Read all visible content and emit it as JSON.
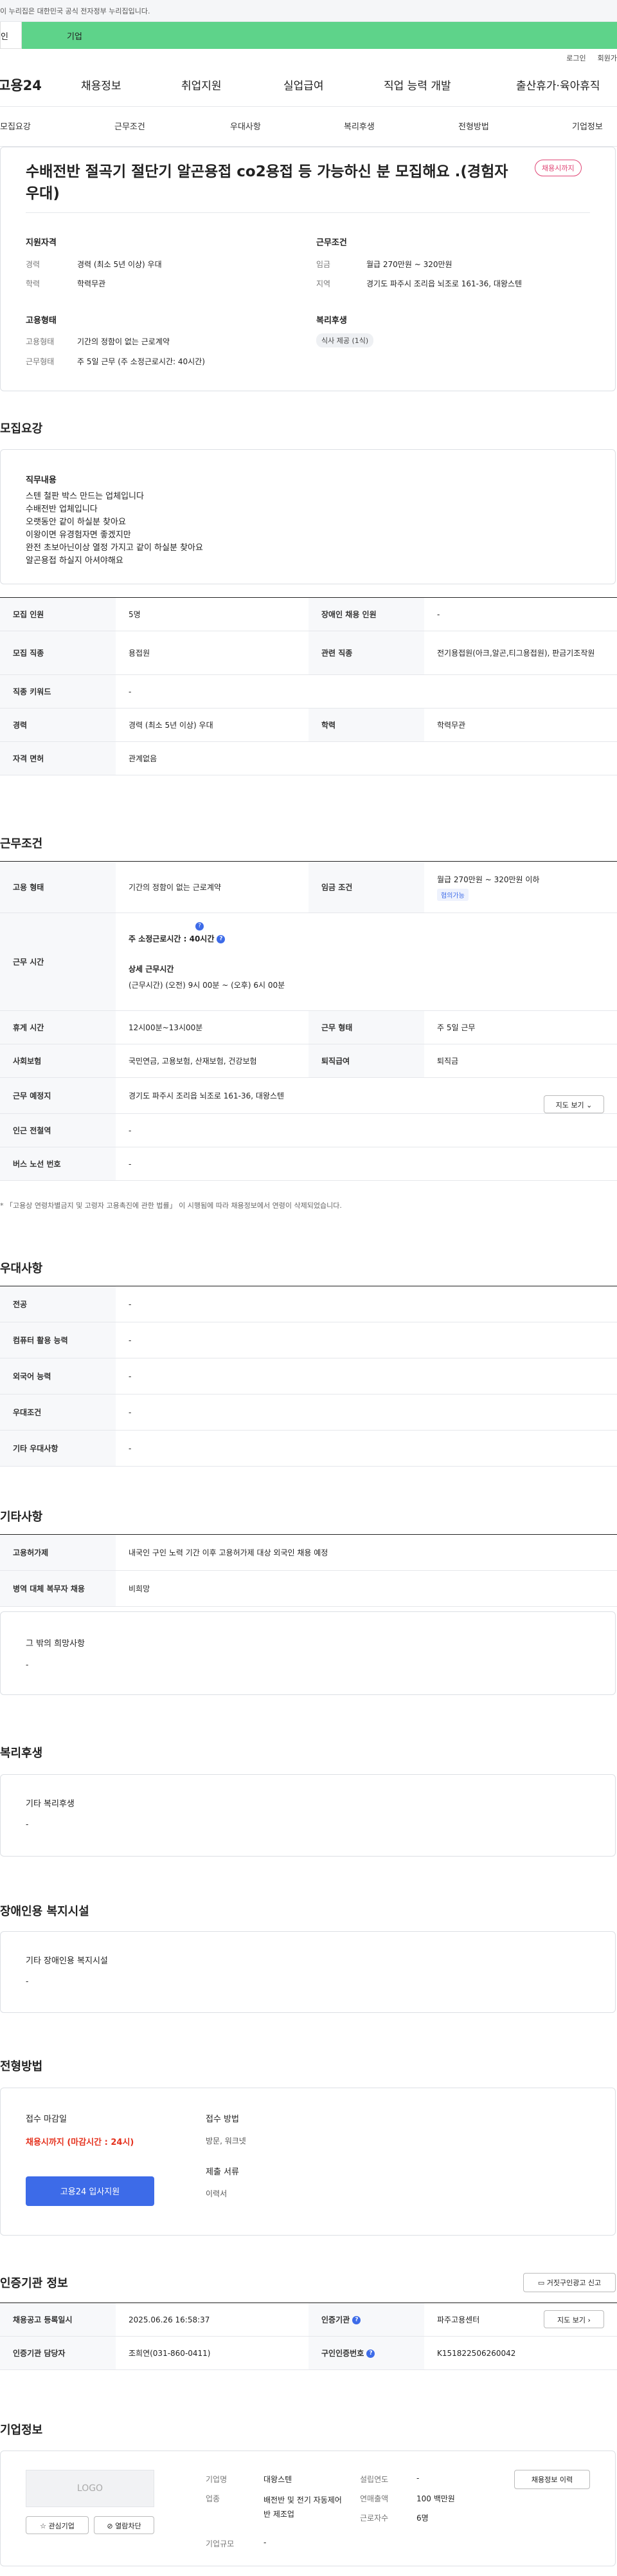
{
  "header": {
    "gov_notice": "이 누리집은 대한민국 공식 전자정부 누리집입니다.",
    "tab_left": "인",
    "tab_right": "기업",
    "util": [
      "로그인",
      "회원가"
    ],
    "logo": "고용24",
    "gnb": [
      "채용정보",
      "취업지원",
      "실업급여",
      "직업 능력 개발",
      "출산휴가·육아휴직"
    ],
    "snb": [
      "모집요강",
      "근무조건",
      "우대사항",
      "복리후생",
      "전형방법",
      "기업정보"
    ]
  },
  "summary": {
    "title": "수배전반 절곡기 절단기 알곤용접 co2용접 등 가능하신 분 모집해요 .(경험자우대)",
    "status": "채용시까지",
    "qual_title": "지원자격",
    "qual": [
      {
        "k": "경력",
        "v": "경력 (최소 5년 이상) 우대"
      },
      {
        "k": "학력",
        "v": "학력무관"
      }
    ],
    "work_title": "근무조건",
    "work": [
      {
        "k": "임금",
        "v": "월급 270만원 ~ 320만원"
      },
      {
        "k": "지역",
        "v": "경기도 파주시 조리읍 뇌조로 161-36, 대왕스텐"
      }
    ],
    "emp_title": "고용형태",
    "emp": [
      {
        "k": "고용형태",
        "v": "기간의 정함이 없는 근로계약"
      },
      {
        "k": "근무형태",
        "v": "주 5일 근무 (주 소정근로시간: 40시간)"
      }
    ],
    "welfare_title": "복리후생",
    "welfare_tag": "식사 제공 (1식)"
  },
  "recruit": {
    "heading": "모집요강",
    "job_title": "직무내용",
    "job_text": "스텐 철판 박스 만드는 업체입니다\n수배전반 업체입니다\n오랫동안 같이 하실분 찾아요\n이왕이면 유경험자면 좋겠지만\n완전 초보아닌이상 열정 가지고 같이 하실분 찾아요\n알곤용접 하실지 아셔야해요",
    "rows": [
      [
        "모집 인원",
        "5명",
        "장애인 채용 인원",
        "-"
      ],
      [
        "모집 직종",
        "용접원",
        "관련 직종",
        "전기용접원(아크,알곤,티그용접원), 판금기조작원"
      ],
      [
        "직종 키워드",
        "-"
      ],
      [
        "경력",
        "경력 (최소 5년 이상) 우대",
        "학력",
        "학력무관"
      ],
      [
        "자격 면허",
        "관계없음"
      ]
    ]
  },
  "conditions": {
    "heading": "근무조건",
    "emp_type_k": "고용 형태",
    "emp_type_v": "기간의 정함이 없는 근로계약",
    "wage_k": "임금 조건",
    "wage_v": "월급 270만원 ~ 320만원 이하",
    "wage_tag": "협의가능",
    "hours_k": "근무 시간",
    "hours_main": "주 소정근로시간 : 40시간",
    "hours_detail_title": "상세 근무시간",
    "hours_detail": "(근무시간) (오전) 9시 00분 ~ (오후) 6시 00분",
    "rows": [
      [
        "휴게 시간",
        "12시00분~13시00분",
        "근무 형태",
        "주 5일 근무"
      ],
      [
        "사회보험",
        "국민연금, 고용보험, 산재보험, 건강보험",
        "퇴직급여",
        "퇴직금"
      ],
      [
        "근무 예정지",
        "경기도 파주시 조리읍 뇌조로 161-36, 대왕스텐"
      ],
      [
        "인근 전철역",
        "-"
      ],
      [
        "버스 노선 번호",
        "-"
      ]
    ],
    "map_btn": "지도 보기",
    "note": "* 「고용상 연령차별금지 및 고령자 고용촉진에 관한 법률」 이 시행됨에 따라 채용정보에서 연령이 삭제되었습니다."
  },
  "prefer": {
    "heading": "우대사항",
    "rows": [
      [
        "전공",
        "-"
      ],
      [
        "컴퓨터 활용 능력",
        "-"
      ],
      [
        "외국어 능력",
        "-"
      ],
      [
        "우대조건",
        "-"
      ],
      [
        "기타 우대사항",
        "-"
      ]
    ]
  },
  "other": {
    "heading": "기타사항",
    "rows": [
      [
        "고용허가제",
        "내국인 구인 노력 기간 이후 고용허가제 대상 외국인 채용 예정"
      ],
      [
        "병역 대체 복무자 채용",
        "비희망"
      ]
    ],
    "box_title": "그 밖의 희망사항",
    "box_value": "-"
  },
  "welfare": {
    "heading": "복리후생",
    "box_title": "기타 복리후생",
    "box_value": "-"
  },
  "disabled": {
    "heading": "장애인용 복지시설",
    "box_title": "기타 장애인용 복지시설",
    "box_value": "-"
  },
  "process": {
    "heading": "전형방법",
    "deadline_title": "접수 마감일",
    "deadline_value": "채용시까지 (마감시간 : 24시)",
    "method_title": "접수 방법",
    "method_value": "방문, 워크넷",
    "docs_title": "제출 서류",
    "docs_value": "이력서",
    "apply_btn": "고용24 입사지원"
  },
  "cert": {
    "heading": "인증기관 정보",
    "report_btn": "거짓구인광고 신고",
    "rows": [
      [
        "채용공고 등록일시",
        "2025.06.26 16:58:37",
        "인증기관",
        "파주고용센터"
      ],
      [
        "인증기관 담당자",
        "조희연(031-860-0411)",
        "구인인증번호",
        "K151822506260042"
      ]
    ],
    "map_btn": "지도 보기"
  },
  "company": {
    "heading": "기업정보",
    "logo_text": "LOGO",
    "fav_btn": "관심기업",
    "block_btn": "열람차단",
    "info_btn": "채용정보 이력",
    "fields": [
      {
        "k": "기업명",
        "v": "대왕스텐"
      },
      {
        "k": "업종",
        "v": "배전반 및 전기 자동제어반 제조업"
      },
      {
        "k": "기업규모",
        "v": "-"
      },
      {
        "k": "설립연도",
        "v": "-"
      },
      {
        "k": "연매출액",
        "v": "100 백만원"
      },
      {
        "k": "근로자수",
        "v": "6명"
      }
    ]
  }
}
